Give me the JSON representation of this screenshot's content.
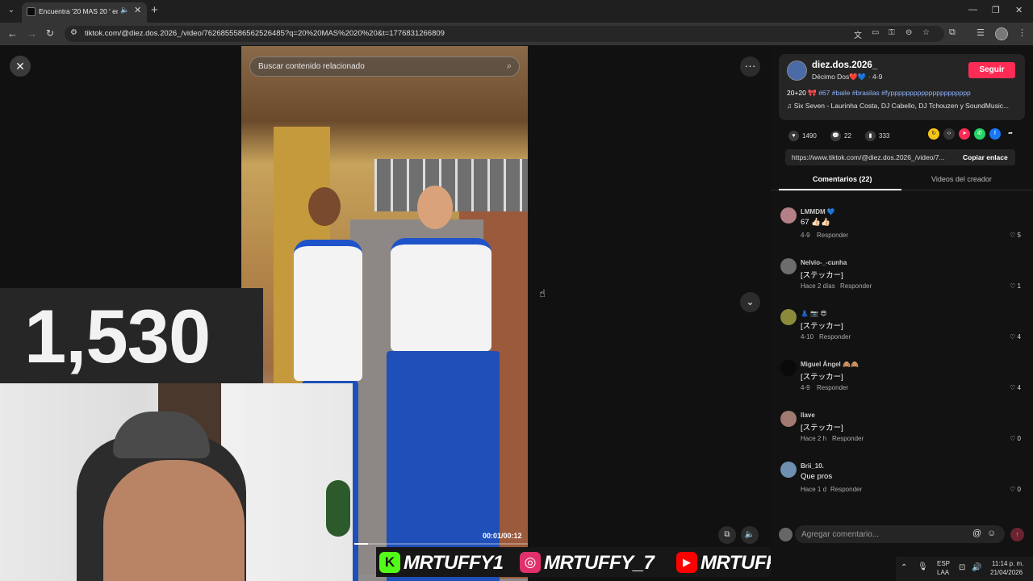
{
  "browser": {
    "tab_title": "Encuentra '20 MAS 20 ' en",
    "url": "tiktok.com/@diez.dos.2026_/video/7626855586562526485?q=20%20MAS%2020%20&t=1776831266809"
  },
  "viewer": {
    "search_placeholder": "Buscar contenido relacionado",
    "time": "00:01/00:12",
    "progress": 0.08
  },
  "overlay": {
    "counter": "1,530",
    "social": [
      {
        "icon": "kick-icon",
        "label": "MRTUFFY1",
        "color": "#53fc18",
        "glyph": "K"
      },
      {
        "icon": "instagram-icon",
        "label": "MRTUFFY_7",
        "color": "#e1306c",
        "glyph": "◎"
      },
      {
        "icon": "youtube-icon",
        "label": "MRTUFFY",
        "color": "#ff0000",
        "glyph": "▶"
      }
    ]
  },
  "panel": {
    "author": "diez.dos.2026_",
    "subtitle": "Décimo Dos❤️💙 · 4-9",
    "follow": "Seguir",
    "desc_prefix": "20+20 🎀",
    "hashtags": "#67 #baile #brasilas #fyppppppppppppppppppppp",
    "music": "♫  Six Seven - Laurinha Costa, DJ Cabello, DJ Tchouzen y SoundMusic...",
    "likes": "1490",
    "comments_count": "22",
    "saves": "333",
    "link": "https://www.tiktok.com/@diez.dos.2026_/video/7...",
    "copy_link": "Copiar enlace",
    "tab_comments": "Comentarios (22)",
    "tab_creator": "Videos del creador",
    "comments": [
      {
        "user": "LMMDM 💙",
        "text": "67 👍🏻👍🏻",
        "meta": "4-9",
        "likes": "♡ 5"
      },
      {
        "user": "Nelvio-_-cunha",
        "text": "[ステッカー]",
        "meta": "Hace 2 días",
        "likes": "♡ 1"
      },
      {
        "user": "👗 📷 😎",
        "text": "[ステッカー]",
        "meta": "4-10",
        "likes": "♡ 4"
      },
      {
        "user": "Miguel Ángel 🙈🙈",
        "text": "[ステッカー]",
        "meta": "4-9",
        "likes": "♡ 4"
      },
      {
        "user": "llave",
        "text": "[ステッカー]",
        "meta": "Hace 2 h",
        "likes": "♡ 0"
      },
      {
        "user": "Brii_10.",
        "text": "Que pros",
        "meta": "Hace 1 d",
        "likes": "♡ 0"
      }
    ],
    "reply_label": "Responder",
    "comment_placeholder": "Agregar comentario..."
  },
  "tray": {
    "lang": "ESP",
    "layout": "LAA",
    "time": "11:14 p. m.",
    "date": "21/04/2026"
  }
}
